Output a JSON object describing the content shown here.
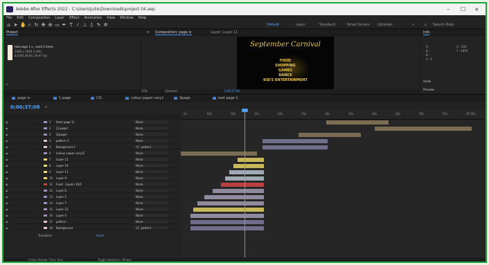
{
  "titlebar": {
    "title": "Adobe After Effects 2022 - C:\\Users\\Julie\\Downloads\\project 04.aep",
    "min": "–",
    "max": "☐",
    "close": "×"
  },
  "menu": [
    "File",
    "Edit",
    "Composition",
    "Layer",
    "Effect",
    "Animation",
    "View",
    "Window",
    "Help"
  ],
  "workspaces": [
    {
      "label": "Default",
      "active": true
    },
    {
      "label": "Learn"
    },
    {
      "label": "Standard"
    },
    {
      "label": "Small Screen"
    },
    {
      "label": "Libraries"
    }
  ],
  "search_help": "Search Help",
  "project": {
    "tab": "Project",
    "comp_name": "text page 1 ▾ , used 3 times",
    "meta1": "1080 x 1920 (1.00)",
    "meta2": "Δ 0;00;30;00, 29.97 fps"
  },
  "comp": {
    "tab": "Composition: page ≡",
    "layer_tab": "Layer: Layer 11",
    "zoom": "25%",
    "res": "(Quarter)",
    "timecode": "0;00;37;08"
  },
  "viewer": {
    "title": "September Carnival",
    "items": [
      "FOOD",
      "SHOPPING",
      "GAMES",
      "DANCE",
      "KID'S ENTERTAINMENT"
    ]
  },
  "info": {
    "tab": "Info",
    "r": "R :",
    "g": "G :",
    "b": "B :",
    "a": "A : 0",
    "x": "X : 236",
    "y": "Y : 1850",
    "audio": "Audio",
    "preview": "Preview"
  },
  "tl_tabs": [
    {
      "label": "page ≡",
      "color": "#3f7fd6"
    },
    {
      "label": "1 page",
      "color": "#3f7fd6"
    },
    {
      "label": "Cl1",
      "color": "#3f7fd6"
    },
    {
      "label": "colour paper vary1",
      "color": "#3f7fd6"
    },
    {
      "label": "3page",
      "color": "#3f7fd6"
    },
    {
      "label": "text page 1",
      "color": "#3f7fd6"
    }
  ],
  "timeline": {
    "timecode": "0;00;37;08",
    "ticks": [
      "0s",
      "05s",
      "10s",
      "15s",
      "20s",
      "25s",
      "30s",
      "35s",
      "40s",
      "45s",
      "50s",
      "55s",
      "01:00s"
    ]
  },
  "layers": [
    {
      "num": "1",
      "name": "[text page 1]",
      "color": "#a38cc9",
      "parent": "None"
    },
    {
      "num": "2",
      "name": "[3 page]",
      "color": "#a38cc9",
      "parent": "None"
    },
    {
      "num": "3",
      "name": "[2page]",
      "color": "#a38cc9",
      "parent": "None"
    },
    {
      "num": "4",
      "name": "pattern 2",
      "color": "#e5c0d6",
      "parent": "None"
    },
    {
      "num": "5",
      "name": "Background 2",
      "color": "#e5c0d6",
      "parent": "17. pattern"
    },
    {
      "num": "6",
      "name": "[colour paper vary1]",
      "color": "#a38cc9",
      "parent": "None"
    },
    {
      "num": "7",
      "name": "Layer 12",
      "color": "#f0d85a",
      "parent": "None"
    },
    {
      "num": "8",
      "name": "Layer 10",
      "color": "#f0d85a",
      "parent": "None"
    },
    {
      "num": "9",
      "name": "Layer 11",
      "color": "#f0d85a",
      "parent": "None"
    },
    {
      "num": "10",
      "name": "Layer 9",
      "color": "#f0d85a",
      "parent": "None"
    },
    {
      "num": "11",
      "name": "Food - Layers 10/1",
      "color": "#d93c3c",
      "parent": "None"
    },
    {
      "num": "12",
      "name": "Layer 8",
      "color": "#a38cc9",
      "parent": "None"
    },
    {
      "num": "13",
      "name": "Layer 5",
      "color": "#a38cc9",
      "parent": "None"
    },
    {
      "num": "14",
      "name": "Layer 7",
      "color": "#a38cc9",
      "parent": "None"
    },
    {
      "num": "15",
      "name": "Layer 23",
      "color": "#a38cc9",
      "parent": "None"
    },
    {
      "num": "16",
      "name": "Layer 4",
      "color": "#a38cc9",
      "parent": "None"
    },
    {
      "num": "17",
      "name": "pattern",
      "color": "#e5c0d6",
      "parent": "None"
    },
    {
      "num": "18",
      "name": "Background",
      "color": "#e5c0d6",
      "parent": "17. pattern"
    }
  ],
  "transform_label": "Transform",
  "reset_label": "Reset",
  "status": {
    "render": "Frame Render Time: 0ms",
    "toggle": "Toggle Switches / Modes"
  }
}
